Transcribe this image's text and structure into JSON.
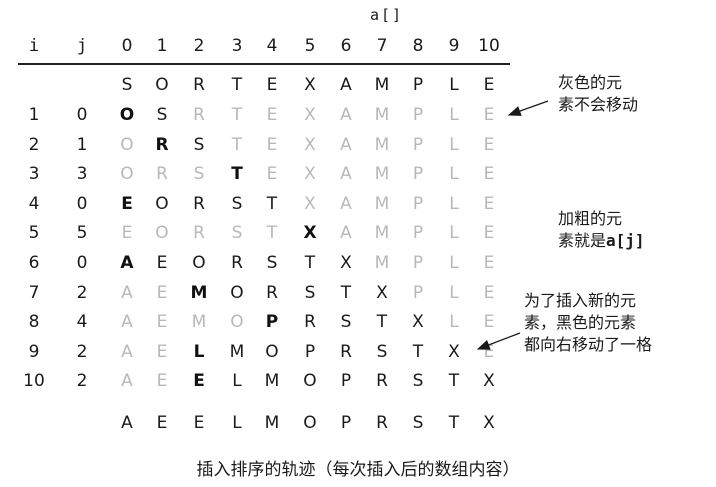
{
  "array_label": "a[]",
  "headers": [
    "i",
    "j",
    "0",
    "1",
    "2",
    "3",
    "4",
    "5",
    "6",
    "7",
    "8",
    "9",
    "10"
  ],
  "initial": [
    "S",
    "O",
    "R",
    "T",
    "E",
    "X",
    "A",
    "M",
    "P",
    "L",
    "E"
  ],
  "rows": [
    {
      "i": "1",
      "j": "0",
      "values": [
        "O",
        "S",
        "R",
        "T",
        "E",
        "X",
        "A",
        "M",
        "P",
        "L",
        "E"
      ]
    },
    {
      "i": "2",
      "j": "1",
      "values": [
        "O",
        "R",
        "S",
        "T",
        "E",
        "X",
        "A",
        "M",
        "P",
        "L",
        "E"
      ]
    },
    {
      "i": "3",
      "j": "3",
      "values": [
        "O",
        "R",
        "S",
        "T",
        "E",
        "X",
        "A",
        "M",
        "P",
        "L",
        "E"
      ]
    },
    {
      "i": "4",
      "j": "0",
      "values": [
        "E",
        "O",
        "R",
        "S",
        "T",
        "X",
        "A",
        "M",
        "P",
        "L",
        "E"
      ]
    },
    {
      "i": "5",
      "j": "5",
      "values": [
        "E",
        "O",
        "R",
        "S",
        "T",
        "X",
        "A",
        "M",
        "P",
        "L",
        "E"
      ]
    },
    {
      "i": "6",
      "j": "0",
      "values": [
        "A",
        "E",
        "O",
        "R",
        "S",
        "T",
        "X",
        "M",
        "P",
        "L",
        "E"
      ]
    },
    {
      "i": "7",
      "j": "2",
      "values": [
        "A",
        "E",
        "M",
        "O",
        "R",
        "S",
        "T",
        "X",
        "P",
        "L",
        "E"
      ]
    },
    {
      "i": "8",
      "j": "4",
      "values": [
        "A",
        "E",
        "M",
        "O",
        "P",
        "R",
        "S",
        "T",
        "X",
        "L",
        "E"
      ]
    },
    {
      "i": "9",
      "j": "2",
      "values": [
        "A",
        "E",
        "L",
        "M",
        "O",
        "P",
        "R",
        "S",
        "T",
        "X",
        "E"
      ]
    },
    {
      "i": "10",
      "j": "2",
      "values": [
        "A",
        "E",
        "E",
        "L",
        "M",
        "O",
        "P",
        "R",
        "S",
        "T",
        "X"
      ]
    }
  ],
  "final": [
    "A",
    "E",
    "E",
    "L",
    "M",
    "O",
    "P",
    "R",
    "S",
    "T",
    "X"
  ],
  "notes": {
    "gray": [
      "灰色的元",
      "素不会移动"
    ],
    "bold_prefix": [
      "加粗的元",
      "素就是"
    ],
    "bold_code": "a[j]",
    "black": [
      "为了插入新的元",
      "素，黑色的元素",
      "都向右移动了一格"
    ]
  },
  "caption": "插入排序的轨迹（每次插入后的数组内容）",
  "colors": {
    "gray": "#b8b8b8",
    "text": "#1a1a1a",
    "rule": "#222222"
  }
}
